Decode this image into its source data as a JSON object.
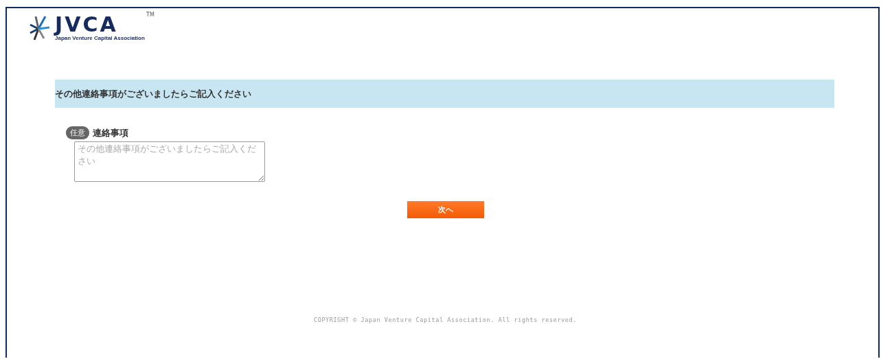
{
  "logo": {
    "mark": "JVCA",
    "trademark": "TM",
    "subtitle": "Japan Venture Capital Association"
  },
  "section": {
    "title": "その他連絡事項がございましたらご記入ください"
  },
  "field": {
    "badge": "任意",
    "label": "連絡事項",
    "placeholder": "その他連絡事項がございましたらご記入ください"
  },
  "next_button": {
    "label": "次へ"
  },
  "footer": {
    "copyright": "COPYRIGHT © Japan Venture Capital Association. All rights reserved."
  }
}
